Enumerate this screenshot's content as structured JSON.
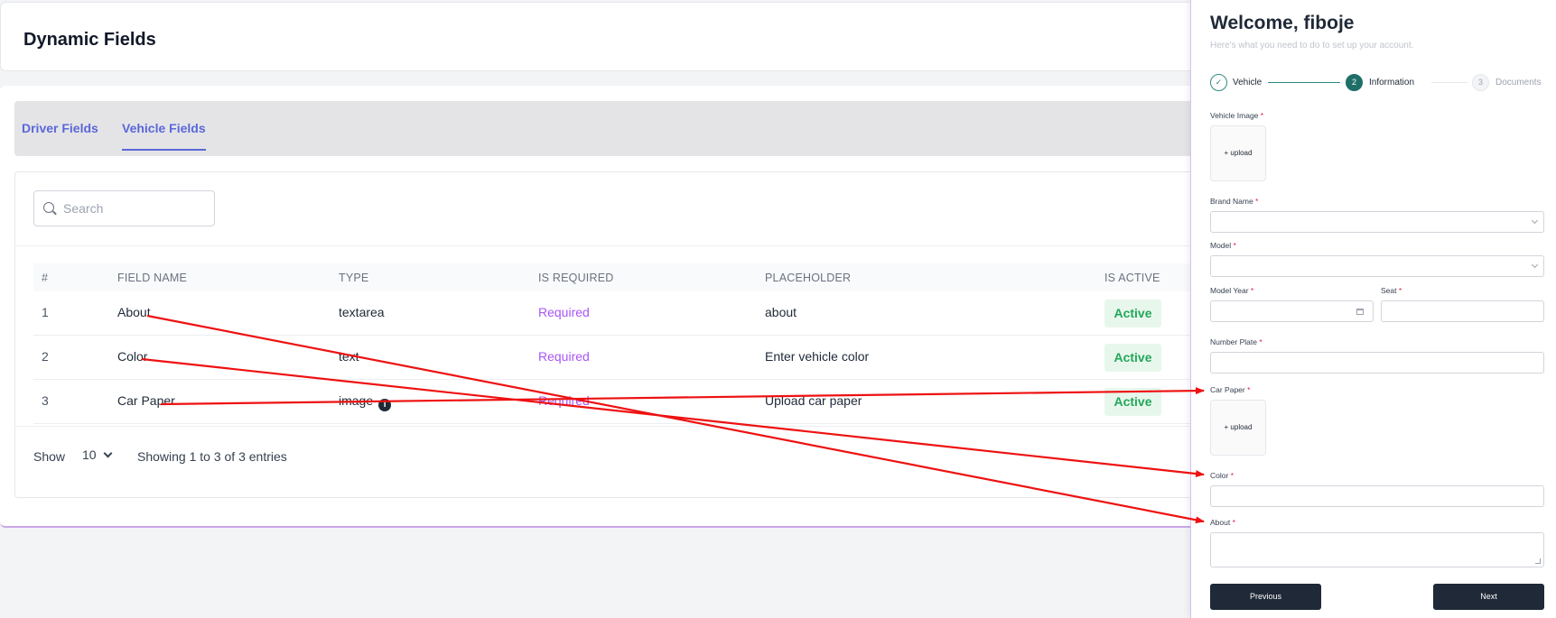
{
  "header": {
    "title": "Dynamic Fields"
  },
  "tabs": [
    {
      "label": "Driver Fields",
      "active": false
    },
    {
      "label": "Vehicle Fields",
      "active": true
    }
  ],
  "search": {
    "placeholder": "Search",
    "value": ""
  },
  "table": {
    "columns": [
      "#",
      "FIELD NAME",
      "TYPE",
      "IS REQUIRED",
      "PLACEHOLDER",
      "IS ACTIVE"
    ],
    "rows": [
      {
        "num": "1",
        "name": "About",
        "type": "textarea",
        "required": "Required",
        "placeholder": "about",
        "active": "Active"
      },
      {
        "num": "2",
        "name": "Color",
        "type": "text",
        "required": "Required",
        "placeholder": "Enter vehicle color",
        "active": "Active"
      },
      {
        "num": "3",
        "name": "Car Paper",
        "type": "image",
        "required": "Required",
        "placeholder": "Upload car paper",
        "active": "Active"
      }
    ]
  },
  "footer": {
    "show_label": "Show",
    "page_size": "10",
    "entries_text": "Showing 1 to 3 of 3 entries"
  },
  "panel": {
    "welcome": "Welcome, fiboje",
    "subtitle": "Here's what you need to do to set up your account.",
    "steps": [
      {
        "num": "",
        "label": "Vehicle",
        "state": "done"
      },
      {
        "num": "2",
        "label": "Information",
        "state": "current"
      },
      {
        "num": "3",
        "label": "Documents",
        "state": "pending"
      }
    ],
    "fields": {
      "vehicle_image": "Vehicle Image",
      "brand_name": "Brand Name",
      "model": "Model",
      "model_year": "Model Year",
      "seat": "Seat",
      "number_plate": "Number Plate",
      "car_paper": "Car Paper",
      "color": "Color",
      "about": "About"
    },
    "upload_label": "+ upload",
    "required_mark": "*",
    "buttons": {
      "previous": "Previous",
      "next": "Next"
    }
  },
  "colors": {
    "accent": "#5b67d8",
    "required": "#a855f7",
    "active": "#22a75a",
    "arrow": "#ee1111",
    "dark_button": "#1f2937",
    "step": "#1f6f68"
  }
}
